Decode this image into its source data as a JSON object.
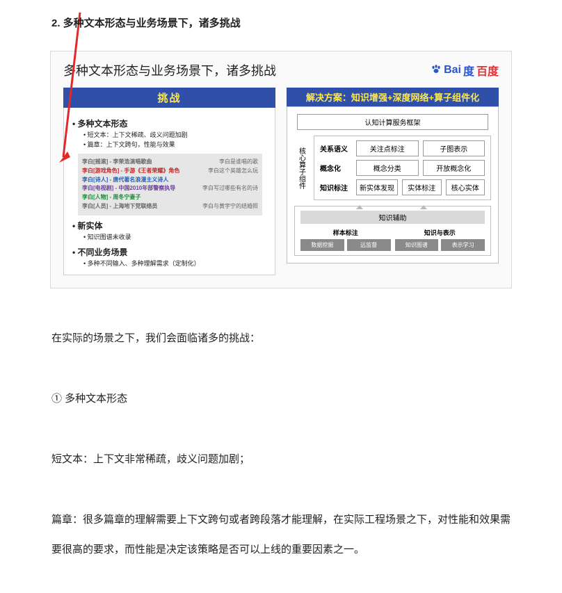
{
  "heading": "2. 多种文本形态与业务场景下，诸多挑战",
  "slide": {
    "title": "多种文本形态与业务场景下，诸多挑战",
    "logo": {
      "roman": "Bai",
      "du_glyph": "度",
      "cn": "百度"
    },
    "left": {
      "bar": "挑战",
      "sec1": {
        "title": "多种文本形态",
        "b1": "短文本：上下文稀疏、歧义问题加剧",
        "b2": "篇章：上下文跨句，性能与效果"
      },
      "example": {
        "r1l": "李白[摇滚] - 李荣浩演唱歌曲",
        "r1r": "李白是谁唱的歌",
        "r2l": "李白[游戏角色] - 手游《王者荣耀》角色",
        "r2r": "李白这个英雄怎么玩",
        "r3l": "李白[诗人] - 唐代著名浪漫主义诗人",
        "r3r": "",
        "r4l": "李白[电视剧] - 中国2010年部警察执导",
        "r4r": "李白写过哪些有名的诗",
        "r5l": "李白[人物] - 周冬宁妻子",
        "r5r": "",
        "r6l": "李白[人员] - 上海地下党联络员",
        "r6r": "李白与黄宇宁的结婚照"
      },
      "sec2": {
        "title": "新实体",
        "b1": "知识图谱未收录"
      },
      "sec3": {
        "title": "不同业务场景",
        "b1": "多种不同输入、多种理解需求（定制化）"
      }
    },
    "right": {
      "bar": "解决方案：知识增强+深度网络+算子组件化",
      "top": "认知计算服务框架",
      "core_side": "核心算子组件",
      "rows": {
        "r1": {
          "label": "关系语义",
          "c1": "关注点标注",
          "c2": "子图表示"
        },
        "r2": {
          "label": "概念化",
          "c1": "概念分类",
          "c2": "开放概念化"
        },
        "r3": {
          "label": "知识标注",
          "c1": "新实体发现",
          "c2": "实体标注",
          "c3": "核心实体"
        }
      },
      "assist": {
        "head": "知识辅助",
        "g1": {
          "title": "样本标注",
          "c1": "数据挖掘",
          "c2": "远监督"
        },
        "g2": {
          "title": "知识与表示",
          "c1": "知识图谱",
          "c2": "表示学习"
        }
      }
    }
  },
  "body": {
    "p1": "在实际的场景之下，我们会面临诸多的挑战：",
    "p2": "① 多种文本形态",
    "p3": "短文本：上下文非常稀疏，歧义问题加剧；",
    "p4": "篇章：很多篇章的理解需要上下文跨句或者跨段落才能理解，在实际工程场景之下，对性能和效果需要很高的要求，而性能是决定该策略是否可以上线的重要因素之一。"
  }
}
